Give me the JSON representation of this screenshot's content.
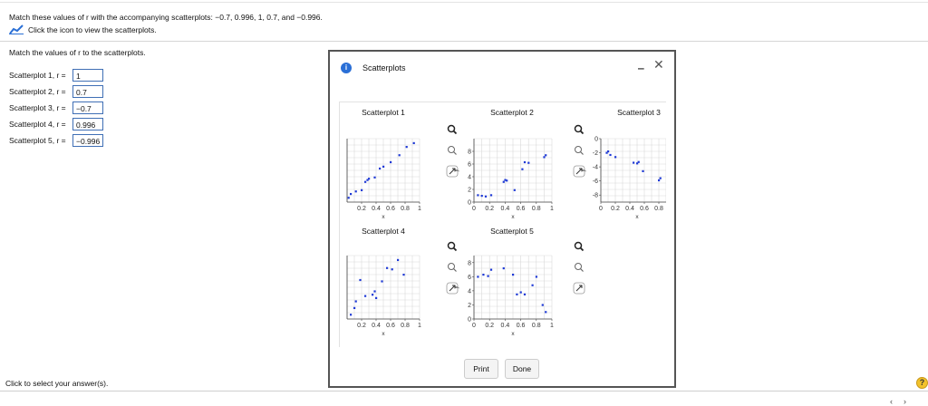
{
  "question": "Match these values of r with the accompanying scatterplots:  −0.7, 0.996, 1, 0.7, and  −0.996.",
  "hint_text": "Click the icon to view the scatterplots.",
  "instruction": "Match the values of r to the scatterplots.",
  "answers": [
    {
      "label": "Scatterplot 1, r =",
      "value": "1"
    },
    {
      "label": "Scatterplot 2, r =",
      "value": "0.7"
    },
    {
      "label": "Scatterplot 3, r =",
      "value": "−0.7"
    },
    {
      "label": "Scatterplot 4, r =",
      "value": "0.996"
    },
    {
      "label": "Scatterplot 5, r =",
      "value": "−0.996"
    }
  ],
  "status_text": "Click to select your answer(s).",
  "help_label": "?",
  "dialog": {
    "info_label": "i",
    "title": "Scatterplots",
    "minimize_label": "‒",
    "close_label": "✕",
    "print_label": "Print",
    "done_label": "Done"
  },
  "chart_data": [
    {
      "type": "scatter",
      "title": "Scatterplot 1",
      "xlabel": "x",
      "ylabel": "",
      "xlim": [
        0,
        1
      ],
      "xticks": [
        0.2,
        0.4,
        0.6,
        0.8,
        1
      ],
      "x": [
        0.02,
        0.05,
        0.12,
        0.2,
        0.25,
        0.28,
        0.3,
        0.38,
        0.45,
        0.5,
        0.6,
        0.72,
        0.82,
        0.92
      ],
      "y": [
        0.06,
        0.12,
        0.16,
        0.18,
        0.31,
        0.34,
        0.36,
        0.38,
        0.52,
        0.55,
        0.62,
        0.73,
        0.86,
        0.92
      ]
    },
    {
      "type": "scatter",
      "title": "Scatterplot 2",
      "xlabel": "x",
      "ylabel": "y",
      "xlim": [
        0,
        1
      ],
      "ylim": [
        0,
        10
      ],
      "xticks": [
        0,
        0.2,
        0.4,
        0.6,
        0.8,
        1
      ],
      "yticks": [
        0,
        2,
        4,
        6,
        8
      ],
      "x": [
        0.05,
        0.1,
        0.15,
        0.22,
        0.38,
        0.4,
        0.42,
        0.52,
        0.62,
        0.65,
        0.7,
        0.9,
        0.92
      ],
      "y": [
        1.1,
        1.0,
        0.9,
        1.1,
        3.2,
        3.5,
        3.4,
        1.9,
        5.2,
        6.3,
        6.2,
        7.1,
        7.4
      ]
    },
    {
      "type": "scatter",
      "title": "Scatterplot 3",
      "xlabel": "x",
      "ylabel": "y",
      "xlim": [
        0,
        1
      ],
      "ylim": [
        -9,
        0
      ],
      "xticks": [
        0,
        0.2,
        0.4,
        0.6,
        0.8
      ],
      "yticks": [
        0,
        -2,
        -4,
        -6,
        -8
      ],
      "x": [
        0.08,
        0.1,
        0.13,
        0.2,
        0.45,
        0.5,
        0.52,
        0.58,
        0.8,
        0.82,
        0.95
      ],
      "y": [
        -2.0,
        -1.8,
        -2.3,
        -2.6,
        -3.4,
        -3.5,
        -3.3,
        -4.6,
        -5.9,
        -5.6,
        -6.8
      ]
    },
    {
      "type": "scatter",
      "title": "Scatterplot 4",
      "xlabel": "x",
      "ylabel": "",
      "xlim": [
        0,
        1
      ],
      "xticks": [
        0.2,
        0.4,
        0.6,
        0.8,
        1
      ],
      "x": [
        0.05,
        0.1,
        0.12,
        0.18,
        0.25,
        0.35,
        0.38,
        0.4,
        0.48,
        0.55,
        0.62,
        0.7,
        0.78
      ],
      "y": [
        0.1,
        0.2,
        0.3,
        0.62,
        0.38,
        0.4,
        0.45,
        0.35,
        0.6,
        0.8,
        0.78,
        0.92,
        0.7
      ]
    },
    {
      "type": "scatter",
      "title": "Scatterplot 5",
      "xlabel": "x",
      "ylabel": "y",
      "xlim": [
        0,
        1
      ],
      "ylim": [
        0,
        9
      ],
      "xticks": [
        0,
        0.2,
        0.4,
        0.6,
        0.8,
        1
      ],
      "yticks": [
        0,
        2,
        4,
        6,
        8
      ],
      "x": [
        0.05,
        0.12,
        0.18,
        0.22,
        0.38,
        0.5,
        0.55,
        0.6,
        0.65,
        0.75,
        0.8,
        0.88,
        0.92
      ],
      "y": [
        6.0,
        6.3,
        6.1,
        7.0,
        7.2,
        6.3,
        3.5,
        3.8,
        3.5,
        4.8,
        6.0,
        2.0,
        1.0
      ]
    }
  ]
}
